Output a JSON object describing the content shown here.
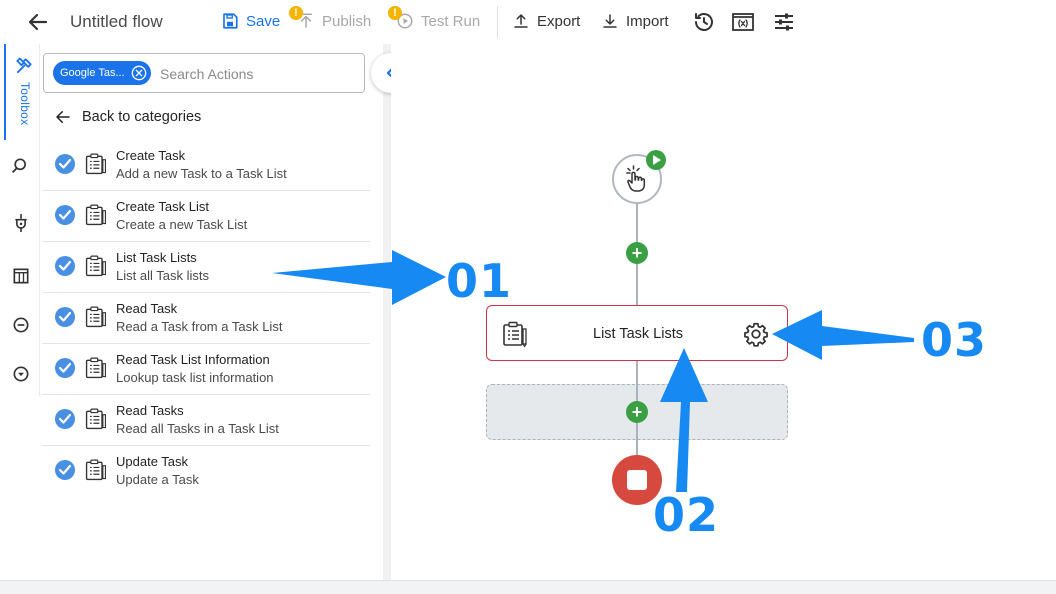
{
  "header": {
    "title": "Untitled flow",
    "save_label": "Save",
    "publish_label": "Publish",
    "testrun_label": "Test Run",
    "export_label": "Export",
    "import_label": "Import",
    "warning_glyph": "!",
    "icons": [
      "back-arrow-icon",
      "save-icon",
      "publish-icon",
      "test-run-icon",
      "export-icon",
      "import-icon",
      "history-icon",
      "variables-icon",
      "settings-sliders-icon"
    ]
  },
  "rail": {
    "toolbox_label": "Toolbox",
    "icons": [
      "toolbox-icon",
      "search-icon",
      "plug-icon",
      "table-icon",
      "minus-circle-icon",
      "chevron-down-circle-icon"
    ]
  },
  "sidebar": {
    "filter_chip": "Google Tas...",
    "search_placeholder": "Search Actions",
    "back_label": "Back to categories",
    "actions": [
      {
        "title": "Create Task",
        "desc": "Add a new Task to a Task List"
      },
      {
        "title": "Create Task List",
        "desc": "Create a new Task List"
      },
      {
        "title": "List Task Lists",
        "desc": "List all Task lists"
      },
      {
        "title": "Read Task",
        "desc": "Read a Task from a Task List"
      },
      {
        "title": "Read Task List Information",
        "desc": "Lookup task list information"
      },
      {
        "title": "Read Tasks",
        "desc": "Read all Tasks in a Task List"
      },
      {
        "title": "Update Task",
        "desc": "Update a Task"
      }
    ]
  },
  "canvas": {
    "step_label": "List Task Lists",
    "add_glyph": "+"
  },
  "annotations": [
    "01",
    "02",
    "03"
  ],
  "colors": {
    "accent": "#1a73e8",
    "annotation": "#1689f2",
    "green": "#3aa043",
    "stop": "#d6493f",
    "step_border": "#c9344a",
    "warning": "#f5b400"
  }
}
